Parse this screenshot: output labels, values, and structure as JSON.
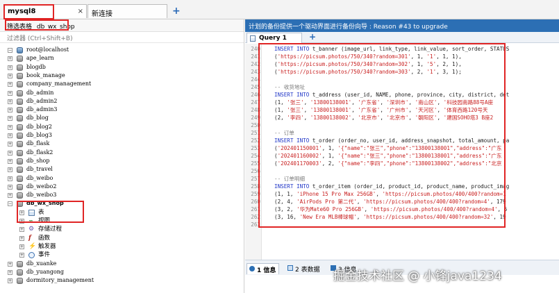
{
  "tabs": {
    "connection": "mysql8",
    "new_connection": "新连接",
    "close_glyph": "×",
    "add_glyph": "+"
  },
  "left": {
    "filter_label": "筛选表格",
    "filter_db": "db_wx_shop",
    "search_placeholder": "过滤器 (Ctrl+Shift+B)",
    "tree": [
      {
        "kind": "server",
        "label": "root@localhost",
        "toggle": "−",
        "level": 0
      },
      {
        "kind": "db",
        "label": "ape_learn",
        "toggle": "+",
        "level": 1
      },
      {
        "kind": "db",
        "label": "blogdb",
        "toggle": "+",
        "level": 1
      },
      {
        "kind": "db",
        "label": "book_manage",
        "toggle": "+",
        "level": 1
      },
      {
        "kind": "db",
        "label": "company_management",
        "toggle": "+",
        "level": 1
      },
      {
        "kind": "db",
        "label": "db_admin",
        "toggle": "+",
        "level": 1
      },
      {
        "kind": "db",
        "label": "db_admin2",
        "toggle": "+",
        "level": 1
      },
      {
        "kind": "db",
        "label": "db_admin3",
        "toggle": "+",
        "level": 1
      },
      {
        "kind": "db",
        "label": "db_blog",
        "toggle": "+",
        "level": 1
      },
      {
        "kind": "db",
        "label": "db_blog2",
        "toggle": "+",
        "level": 1
      },
      {
        "kind": "db",
        "label": "db_blog3",
        "toggle": "+",
        "level": 1
      },
      {
        "kind": "db",
        "label": "db_flask",
        "toggle": "+",
        "level": 1
      },
      {
        "kind": "db",
        "label": "db_flask2",
        "toggle": "+",
        "level": 1
      },
      {
        "kind": "db",
        "label": "db_shop",
        "toggle": "+",
        "level": 1
      },
      {
        "kind": "db",
        "label": "db_travel",
        "toggle": "+",
        "level": 1
      },
      {
        "kind": "db",
        "label": "db_weibo",
        "toggle": "+",
        "level": 1
      },
      {
        "kind": "db",
        "label": "db_weibo2",
        "toggle": "+",
        "level": 1
      },
      {
        "kind": "db",
        "label": "db_weibo3",
        "toggle": "+",
        "level": 1
      },
      {
        "kind": "db",
        "label": "db_wx_shop",
        "toggle": "−",
        "level": 1,
        "bold": true
      },
      {
        "kind": "table",
        "label": "表",
        "toggle": "+",
        "level": 2
      },
      {
        "kind": "view",
        "label": "视图",
        "toggle": "+",
        "level": 2
      },
      {
        "kind": "proc",
        "label": "存储过程",
        "toggle": "+",
        "level": 2
      },
      {
        "kind": "func",
        "label": "函数",
        "toggle": "+",
        "level": 2
      },
      {
        "kind": "trig",
        "label": "触发器",
        "toggle": "+",
        "level": 2
      },
      {
        "kind": "event",
        "label": "事件",
        "toggle": "+",
        "level": 2
      },
      {
        "kind": "db",
        "label": "db_xuanke",
        "toggle": "+",
        "level": 1
      },
      {
        "kind": "db",
        "label": "db_yuangong",
        "toggle": "+",
        "level": 1
      },
      {
        "kind": "db",
        "label": "dormitory_management",
        "toggle": "+",
        "level": 1
      }
    ]
  },
  "right": {
    "info_bar": "计划的备份提供一个驱动界面进行备份向导 : Reason #43 to upgrade",
    "query_tab": "Query 1",
    "add_glyph": "+",
    "code_lines": [
      {
        "n": "240",
        "parts": [
          [
            "kw",
            "INSERT INTO "
          ],
          [
            "plain",
            "t_banner (image_url, link_type, link_value, sort_order, STATUS"
          ]
        ]
      },
      {
        "n": "241",
        "parts": [
          [
            "plain",
            "("
          ],
          [
            "str",
            "'https://picsum.photos/750/340?random=301'"
          ],
          [
            "plain",
            ", 1, "
          ],
          [
            "str",
            "'1'"
          ],
          [
            "plain",
            ", 1, 1),"
          ]
        ]
      },
      {
        "n": "242",
        "parts": [
          [
            "plain",
            "("
          ],
          [
            "str",
            "'https://picsum.photos/750/340?random=302'"
          ],
          [
            "plain",
            ", 1, "
          ],
          [
            "str",
            "'5'"
          ],
          [
            "plain",
            ", 2, 1),"
          ]
        ]
      },
      {
        "n": "243",
        "parts": [
          [
            "plain",
            "("
          ],
          [
            "str",
            "'https://picsum.photos/750/340?random=303'"
          ],
          [
            "plain",
            ", 2, "
          ],
          [
            "str",
            "'1'"
          ],
          [
            "plain",
            ", 3, 1);"
          ]
        ]
      },
      {
        "n": "244",
        "parts": []
      },
      {
        "n": "245",
        "parts": [
          [
            "cmt",
            "-- 收货地址"
          ]
        ]
      },
      {
        "n": "246",
        "parts": [
          [
            "kw",
            "INSERT INTO "
          ],
          [
            "plain",
            "t_address (user_id, NAME, phone, province, city, district, det"
          ]
        ]
      },
      {
        "n": "247",
        "parts": [
          [
            "plain",
            "(1, "
          ],
          [
            "str",
            "'张三'"
          ],
          [
            "plain",
            ", "
          ],
          [
            "str",
            "'13800138001'"
          ],
          [
            "plain",
            ", "
          ],
          [
            "str",
            "'广东省'"
          ],
          [
            "plain",
            ", "
          ],
          [
            "str",
            "'深圳市'"
          ],
          [
            "plain",
            ", "
          ],
          [
            "str",
            "'南山区'"
          ],
          [
            "plain",
            ", "
          ],
          [
            "str",
            "'科技园南路88号A座"
          ]
        ]
      },
      {
        "n": "248",
        "parts": [
          [
            "plain",
            "(1, "
          ],
          [
            "str",
            "'张三'"
          ],
          [
            "plain",
            ", "
          ],
          [
            "str",
            "'13800138001'"
          ],
          [
            "plain",
            ", "
          ],
          [
            "str",
            "'广东省'"
          ],
          [
            "plain",
            ", "
          ],
          [
            "str",
            "'广州市'"
          ],
          [
            "plain",
            ", "
          ],
          [
            "str",
            "'天河区'"
          ],
          [
            "plain",
            ", "
          ],
          [
            "str",
            "'体育西路120号天"
          ]
        ]
      },
      {
        "n": "249",
        "parts": [
          [
            "plain",
            "(2, "
          ],
          [
            "str",
            "'李四'"
          ],
          [
            "plain",
            ", "
          ],
          [
            "str",
            "'13800138002'"
          ],
          [
            "plain",
            ", "
          ],
          [
            "str",
            "'北京市'"
          ],
          [
            "plain",
            ", "
          ],
          [
            "str",
            "'北京市'"
          ],
          [
            "plain",
            ", "
          ],
          [
            "str",
            "'朝阳区'"
          ],
          [
            "plain",
            ", "
          ],
          [
            "str",
            "'建国SOHO塔3 B座2"
          ]
        ]
      },
      {
        "n": "250",
        "parts": []
      },
      {
        "n": "251",
        "parts": [
          [
            "cmt",
            "-- 订单"
          ]
        ]
      },
      {
        "n": "252",
        "parts": [
          [
            "kw",
            "INSERT INTO "
          ],
          [
            "plain",
            "t_order (order_no, user_id, address_snapshot, total_amount, pa"
          ]
        ]
      },
      {
        "n": "253",
        "parts": [
          [
            "plain",
            "("
          ],
          [
            "str",
            "'202401150001'"
          ],
          [
            "plain",
            ", 1, "
          ],
          [
            "str",
            "'{\"name\":\"张三\",\"phone\":\"13800138001\",\"address\":\"广东"
          ]
        ]
      },
      {
        "n": "254",
        "parts": [
          [
            "plain",
            "("
          ],
          [
            "str",
            "'202401160002'"
          ],
          [
            "plain",
            ", 1, "
          ],
          [
            "str",
            "'{\"name\":\"张三\",\"phone\":\"13800138001\",\"address\":\"广东"
          ]
        ]
      },
      {
        "n": "255",
        "parts": [
          [
            "plain",
            "("
          ],
          [
            "str",
            "'202401170003'"
          ],
          [
            "plain",
            ", 2, "
          ],
          [
            "str",
            "'{\"name\":\"李四\",\"phone\":\"13800138002\",\"address\":\"北京"
          ]
        ]
      },
      {
        "n": "256",
        "parts": []
      },
      {
        "n": "257",
        "parts": [
          [
            "cmt",
            "-- 订单明细"
          ]
        ]
      },
      {
        "n": "258",
        "parts": [
          [
            "kw",
            "INSERT INTO "
          ],
          [
            "plain",
            "t_order_item (order_id, product_id, product_name, product_imag"
          ]
        ]
      },
      {
        "n": "259",
        "parts": [
          [
            "plain",
            "(1, 1, "
          ],
          [
            "str",
            "'iPhone 15 Pro Max 256GB'"
          ],
          [
            "plain",
            ", "
          ],
          [
            "str",
            "'https://picsum.photos/400/400?random=1"
          ]
        ]
      },
      {
        "n": "260",
        "parts": [
          [
            "plain",
            "(2, 4, "
          ],
          [
            "str",
            "'AirPods Pro 第二代'"
          ],
          [
            "plain",
            ", "
          ],
          [
            "str",
            "'https://picsum.photos/400/400?random=4'"
          ],
          [
            "plain",
            ", 179"
          ]
        ]
      },
      {
        "n": "261",
        "parts": [
          [
            "plain",
            "(3, 2, "
          ],
          [
            "str",
            "'华为Mate60 Pro 256GB'"
          ],
          [
            "plain",
            ", "
          ],
          [
            "str",
            "'https://picsum.photos/400/400?random=4'"
          ],
          [
            "plain",
            ", 6"
          ]
        ]
      },
      {
        "n": "262",
        "parts": [
          [
            "plain",
            "(3, 16, "
          ],
          [
            "str",
            "'New Era MLB棒球帽'"
          ],
          [
            "plain",
            ", "
          ],
          [
            "str",
            "'https://picsum.photos/400/400?random=32'"
          ],
          [
            "plain",
            ", 19"
          ]
        ]
      },
      {
        "n": "263",
        "parts": []
      }
    ],
    "result_tabs": {
      "info": "1 信息",
      "table": "2 表数据",
      "state": "3 信息"
    }
  },
  "watermark": "掘金技术社区 @ 小锋java1234",
  "colors": {
    "info_bar_bg": "#2c6fb4",
    "highlight": "#e02424",
    "keyword": "#1f35c7",
    "string": "#c81e1e"
  }
}
